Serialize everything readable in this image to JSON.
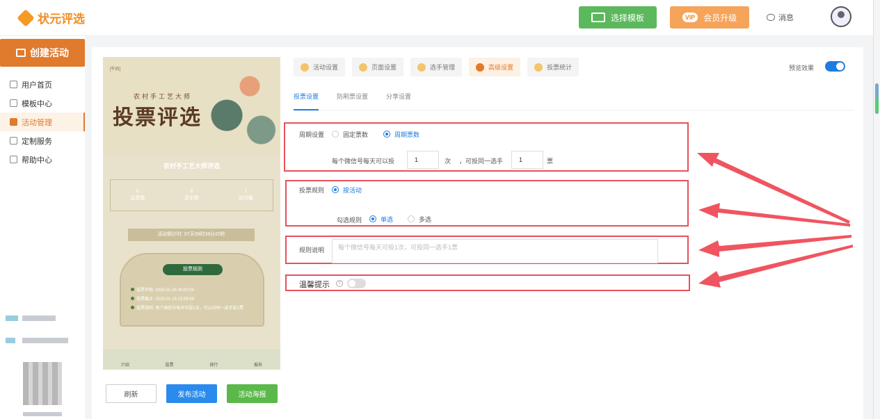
{
  "header": {
    "logo_text": "状元评选",
    "template_button": "选择模板",
    "vip_badge": "VIP",
    "vip_button": "会员升级",
    "messages": "消息"
  },
  "sidebar": {
    "create_button": "创建活动",
    "items": [
      {
        "label": "用户首页",
        "icon": "home-icon"
      },
      {
        "label": "模板中心",
        "icon": "folder-icon"
      },
      {
        "label": "活动管理",
        "icon": "ticket-icon",
        "active": true
      },
      {
        "label": "定制服务",
        "icon": "handshake-icon"
      },
      {
        "label": "帮助中心",
        "icon": "book-icon"
      }
    ]
  },
  "preview": {
    "tag": "[午后]",
    "subtitle": "农村手工艺大师",
    "title": "投票评选",
    "event_name": "农村手工艺大师评选",
    "stats": [
      {
        "value": "0",
        "label": "总票数"
      },
      {
        "value": "6",
        "label": "选手数"
      },
      {
        "value": "1",
        "label": "访问量"
      }
    ],
    "countdown": "活动倒计时: 07天09时39分20秒",
    "rules_title": "投票规则",
    "rules": [
      "投票开始: 2025-01-05 00:00:00",
      "投票截止: 2025-01-15 23:59:59",
      "投票规则: 每个微信号每天可投1次，可以对同一选手投1票"
    ],
    "tabs": [
      "介绍",
      "投票",
      "排行",
      "报名"
    ]
  },
  "actions": {
    "refresh": "刷新",
    "publish": "发布活动",
    "poster": "活动海报"
  },
  "tabs": [
    {
      "label": "活动设置"
    },
    {
      "label": "页面设置"
    },
    {
      "label": "选手管理"
    },
    {
      "label": "高级设置",
      "active": true
    },
    {
      "label": "投票统计"
    }
  ],
  "preview_toggle_label": "预览效果",
  "subtabs": [
    {
      "label": "投票设置",
      "active": true
    },
    {
      "label": "防刷票设置"
    },
    {
      "label": "分享设置"
    }
  ],
  "form": {
    "period": {
      "label": "周期设置",
      "option_fixed": "固定票数",
      "option_cycle": "周期票数",
      "prefix": "每个微信号每天可以投",
      "times_value": "1",
      "times_unit": "次",
      "mid": "，可投同一选手",
      "votes_value": "1",
      "votes_unit": "票"
    },
    "rules": {
      "label": "投票规则",
      "option_activity": "按活动",
      "select_label": "勾选规则",
      "option_single": "单选",
      "option_multi": "多选"
    },
    "desc": {
      "label": "规则说明",
      "placeholder": "每个微信号每天可投1次，可投同一选手1票"
    },
    "tips": {
      "label": "温馨提示",
      "help": "?"
    }
  }
}
